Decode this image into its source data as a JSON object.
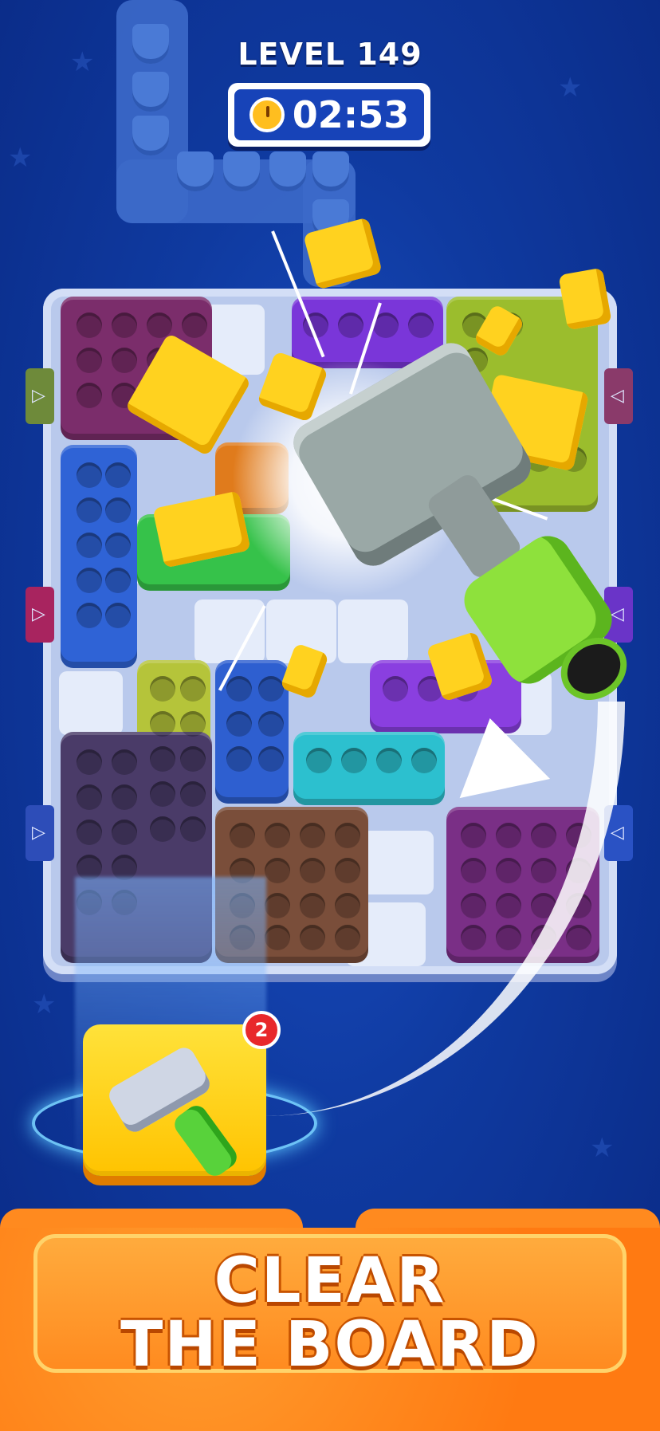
{
  "header": {
    "level_label": "LEVEL 149",
    "timer": "02:53",
    "timer_icon": "stopwatch-icon"
  },
  "booster": {
    "icon": "hammer-icon",
    "count": "2"
  },
  "banner": {
    "line1": "CLEAR",
    "line2": "THE BOARD"
  },
  "colors": {
    "background": "#0f3aa0",
    "banner": "#ff7a12",
    "booster_card": "#ffd21f",
    "badge": "#e8282b",
    "hammer_handle": "#8ee13c"
  },
  "blocks": [
    {
      "color": "#7b2d6b",
      "name": "maroon"
    },
    {
      "color": "#2f63d6",
      "name": "blue"
    },
    {
      "color": "#7a36d9",
      "name": "purple"
    },
    {
      "color": "#9bbd2d",
      "name": "olive"
    },
    {
      "color": "#e07b1c",
      "name": "orange"
    },
    {
      "color": "#36c24a",
      "name": "green"
    },
    {
      "color": "#b5c43a",
      "name": "yellow-green"
    },
    {
      "color": "#2e5fd0",
      "name": "blue"
    },
    {
      "color": "#8a3fe0",
      "name": "violet"
    },
    {
      "color": "#2cc0cf",
      "name": "cyan"
    },
    {
      "color": "#4a3b68",
      "name": "dark-purple"
    },
    {
      "color": "#7a4e3a",
      "name": "brown"
    },
    {
      "color": "#7a2f86",
      "name": "plum"
    }
  ]
}
